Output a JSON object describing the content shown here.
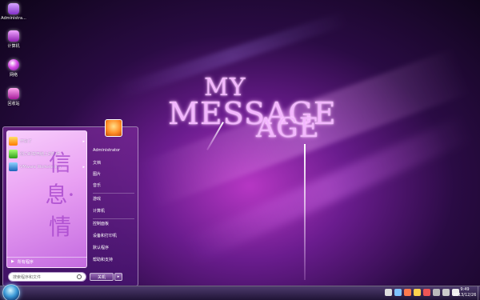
{
  "desktop": {
    "icons": [
      {
        "label": "Administra..."
      },
      {
        "label": "计算机"
      },
      {
        "label": "网络"
      },
      {
        "label": "回收站"
      }
    ],
    "wallpaper_text": {
      "line1": "MY",
      "line2": "MESSAGE",
      "line3": "AGE"
    }
  },
  "start_menu": {
    "programs": [
      {
        "label": "开始了"
      },
      {
        "label": "强力卸载电脑上的软件"
      },
      {
        "label": "VMware Workstation"
      }
    ],
    "decor_chars": "信息·情",
    "all_programs": "所有程序",
    "search_placeholder": "搜索程序和文件",
    "right_links": [
      "Administrator",
      "文档",
      "图片",
      "音乐",
      "游戏",
      "计算机",
      "控制面板",
      "设备和打印机",
      "默认程序",
      "帮助和支持"
    ],
    "shutdown_label": "关机",
    "shutdown_arrow": "▸"
  },
  "taskbar": {
    "time": "9:49",
    "date": "2013/12/26"
  },
  "colors": {
    "accent": "#b637c4",
    "start_pane": "#e9a0f3"
  }
}
